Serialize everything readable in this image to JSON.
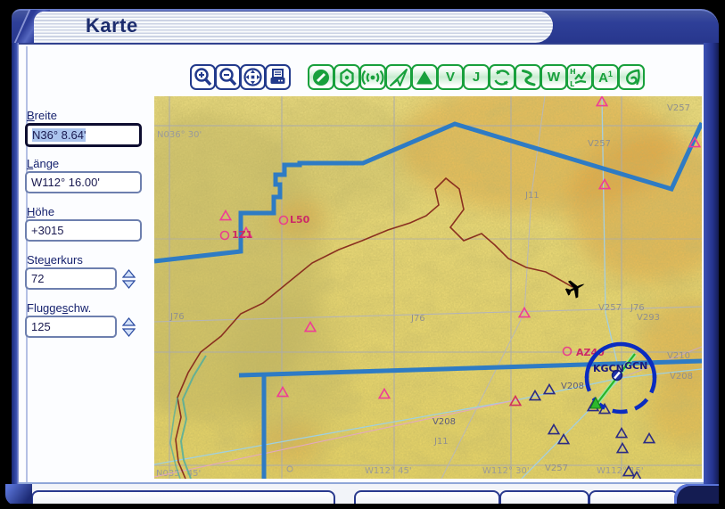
{
  "window": {
    "title": "Karte"
  },
  "toolbar": {
    "nav_buttons": [
      {
        "name": "zoom-in"
      },
      {
        "name": "zoom-out"
      },
      {
        "name": "pan"
      },
      {
        "name": "print"
      }
    ],
    "layer_buttons": [
      {
        "name": "airports-toggle"
      },
      {
        "name": "ndb-toggle"
      },
      {
        "name": "ils-toggle"
      },
      {
        "name": "vfr-toggle"
      },
      {
        "name": "intersections-toggle"
      },
      {
        "name": "victor-airways-toggle",
        "label": "V"
      },
      {
        "name": "jet-airways-toggle",
        "label": "J"
      },
      {
        "name": "airspace-toggle"
      },
      {
        "name": "flightplan-toggle"
      },
      {
        "name": "weather-toggle",
        "label": "W"
      },
      {
        "name": "pressure-toggle",
        "label_top": "H",
        "label_bottom": "L"
      },
      {
        "name": "terrain-text-toggle",
        "label": "A",
        "label_sup": "1"
      },
      {
        "name": "wind-toggle"
      }
    ]
  },
  "form": {
    "breite": {
      "label": "Breite",
      "mnemonic": 0,
      "value": "N36° 8.64'"
    },
    "laenge": {
      "label": "Länge",
      "mnemonic": 0,
      "value": "W112° 16.00'"
    },
    "hoehe": {
      "label": "Höhe",
      "mnemonic": 0,
      "value": "+3015"
    },
    "steuerkurs": {
      "label": "Steuerkurs",
      "mnemonic": 3,
      "value": "72"
    },
    "fluggeschw": {
      "label": "Fluggeschw.",
      "mnemonic": 6,
      "value": "125"
    }
  },
  "map": {
    "grid_labels": {
      "lat_a": "N036° 30'",
      "lat_b": "N035° 45'",
      "lon_a": "W112° 45'",
      "lon_b": "W112° 30'",
      "lon_c": "W112° 15'"
    },
    "airway_labels": {
      "j76_a": "J76",
      "j76_b": "J76",
      "j76_c": "J76",
      "v293": "V293",
      "v257_a": "V257",
      "v257_b": "V257",
      "v257_c": "V257",
      "v257_d": "V257",
      "v208_a": "V208",
      "v208_b": "V208",
      "v208_c": "V208",
      "v210": "V210",
      "j11_a": "J11",
      "j11_b": "J11"
    },
    "airports": {
      "l50": "L50",
      "z1": "1Z1",
      "az40": "AZ40",
      "kgcn": "KGCN",
      "gcn": "GCN"
    }
  },
  "colors": {
    "frame_blue": "#2e3f98",
    "accent_navy": "#1c2c6e",
    "toolbar_green": "#18a03c",
    "terrain_yellow": "#e9d977",
    "boundary_blue": "#2e7bc4",
    "airport_magenta": "#d42a6e",
    "waypoint_navy": "#2b2b84",
    "route_green": "#2db82d",
    "selection_blue": "#abc4ee"
  }
}
